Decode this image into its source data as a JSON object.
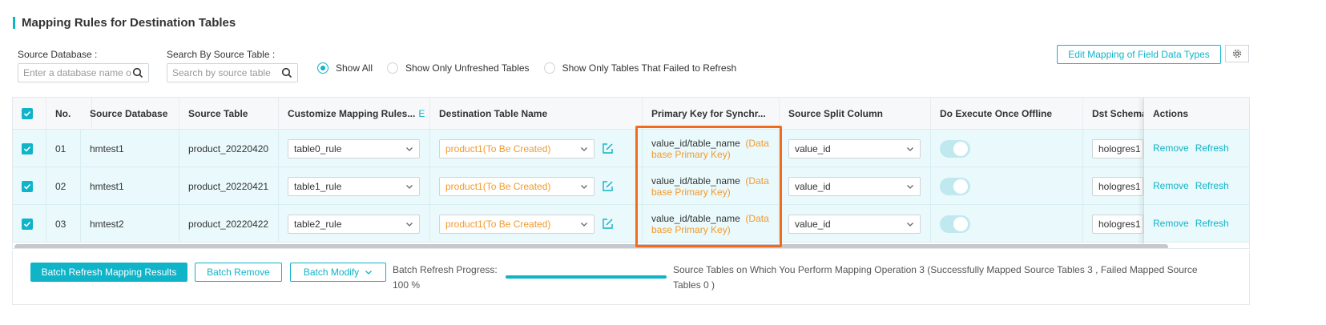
{
  "section": {
    "title": "Mapping Rules for Destination Tables"
  },
  "filters": {
    "source_db_label": "Source Database :",
    "source_db_placeholder": "Enter a database name o",
    "source_table_label": "Search By Source Table :",
    "source_table_placeholder": "Search by source table",
    "radios": [
      {
        "label": "Show All",
        "checked": true
      },
      {
        "label": "Show Only Unfreshed Tables",
        "checked": false
      },
      {
        "label": "Show Only Tables That Failed to Refresh",
        "checked": false
      }
    ]
  },
  "toolbar": {
    "edit_mapping_label": "Edit Mapping of Field Data Types"
  },
  "table": {
    "headers": {
      "no": "No.",
      "source_db": "Source Database",
      "source_table": "Source Table",
      "mapping_rules": "Customize Mapping Rules...",
      "mapping_rules_suffix": "E",
      "dest_table": "Destination Table Name",
      "primary_key": "Primary Key for Synchr...",
      "split_column": "Source Split Column",
      "offline": "Do Execute Once Offline",
      "dst_schema": "Dst Schema",
      "actions": "Actions"
    },
    "rows": [
      {
        "no": "01",
        "source_db": "hmtest1",
        "source_table": "product_20220420",
        "rule": "table0_rule",
        "dest": "product1(To Be Created)",
        "pk": "value_id/table_name",
        "pk_note": "(Data base Primary Key)",
        "split": "value_id",
        "schema": "hologres1"
      },
      {
        "no": "02",
        "source_db": "hmtest1",
        "source_table": "product_20220421",
        "rule": "table1_rule",
        "dest": "product1(To Be Created)",
        "pk": "value_id/table_name",
        "pk_note": "(Data base Primary Key)",
        "split": "value_id",
        "schema": "hologres1"
      },
      {
        "no": "03",
        "source_db": "hmtest2",
        "source_table": "product_20220422",
        "rule": "table2_rule",
        "dest": "product1(To Be Created)",
        "pk": "value_id/table_name",
        "pk_note": "(Data base Primary Key)",
        "split": "value_id",
        "schema": "hologres1"
      }
    ],
    "actions": {
      "remove": "Remove",
      "refresh": "Refresh"
    }
  },
  "footer": {
    "batch_refresh": "Batch Refresh Mapping Results",
    "batch_remove": "Batch Remove",
    "batch_modify": "Batch Modify",
    "progress_label": "Batch Refresh Progress:",
    "progress_value": "100 %",
    "progress_fraction": 1.0,
    "summary_line1": "Source Tables on Which You Perform Mapping Operation  3  (Successfully Mapped Source Tables  3  , Failed Mapped Source",
    "summary_line2": "Tables  0 )"
  },
  "colors": {
    "accent": "#0fb4c8",
    "highlight": "#f26b1d",
    "orange_text": "#f29a2e",
    "row_bg": "#eaf9fb"
  }
}
